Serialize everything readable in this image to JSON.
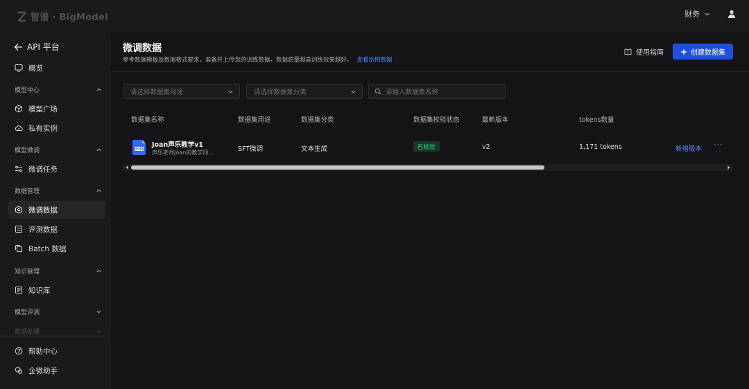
{
  "header": {
    "logo_text": "智谱 · BigModel",
    "finance_label": "财务"
  },
  "sidebar": {
    "back_label": "API 平台",
    "overview_label": "概览",
    "groups": [
      {
        "label": "模型中心",
        "items": [
          "模型广场",
          "私有实例"
        ]
      },
      {
        "label": "模型微调",
        "items": [
          "微调任务"
        ]
      },
      {
        "label": "数据管理",
        "items": [
          "微调数据",
          "评测数据",
          "Batch 数据"
        ]
      },
      {
        "label": "知识管理",
        "items": [
          "知识库"
        ]
      },
      {
        "label": "模型评测",
        "items": []
      },
      {
        "label": "数据处理",
        "items": []
      }
    ],
    "active_item": "微调数据",
    "footer_items": [
      "帮助中心",
      "企微助手"
    ]
  },
  "page": {
    "title": "微调数据",
    "description": "参考数据模板及数据格式要求，准备并上传您的训练数据，数据质量越高训练效果越好。",
    "example_link": "查看示例数据",
    "guide_label": "使用指南",
    "create_label": "创建数据集"
  },
  "filters": {
    "purpose_placeholder": "请选择数据集用途",
    "category_placeholder": "请选择数据集分类",
    "search_placeholder": "请输入数据集名称"
  },
  "table": {
    "columns": [
      "数据集名称",
      "数据集用途",
      "数据集分类",
      "数据集校验状态",
      "最新版本",
      "tokens数量"
    ],
    "rows": [
      {
        "name": "Joan声乐教学v1",
        "description": "声乐老师Joan的教学问...",
        "purpose": "SFT微调",
        "category": "文本生成",
        "status": "已校验",
        "version": "v2",
        "tokens": "1,171 tokens",
        "action": "新增版本",
        "more": "···",
        "file_badge": "JSONL"
      }
    ]
  },
  "colors": {
    "accent": "#1f4fe0",
    "link": "#4d8bff",
    "status_ok_text": "#3dd68c",
    "status_ok_bg": "#16392a"
  },
  "icons": {
    "back": "arrow-left-icon",
    "overview": "monitor-icon",
    "model_plaza": "cube-icon",
    "private_instance": "cloud-icon",
    "finetune_task": "sliders-icon",
    "finetune_data": "dataset-icon",
    "eval_data": "list-icon",
    "batch_data": "copy-icon",
    "knowledge": "book-icon",
    "help": "help-circle-icon",
    "assistant": "chat-icon"
  }
}
